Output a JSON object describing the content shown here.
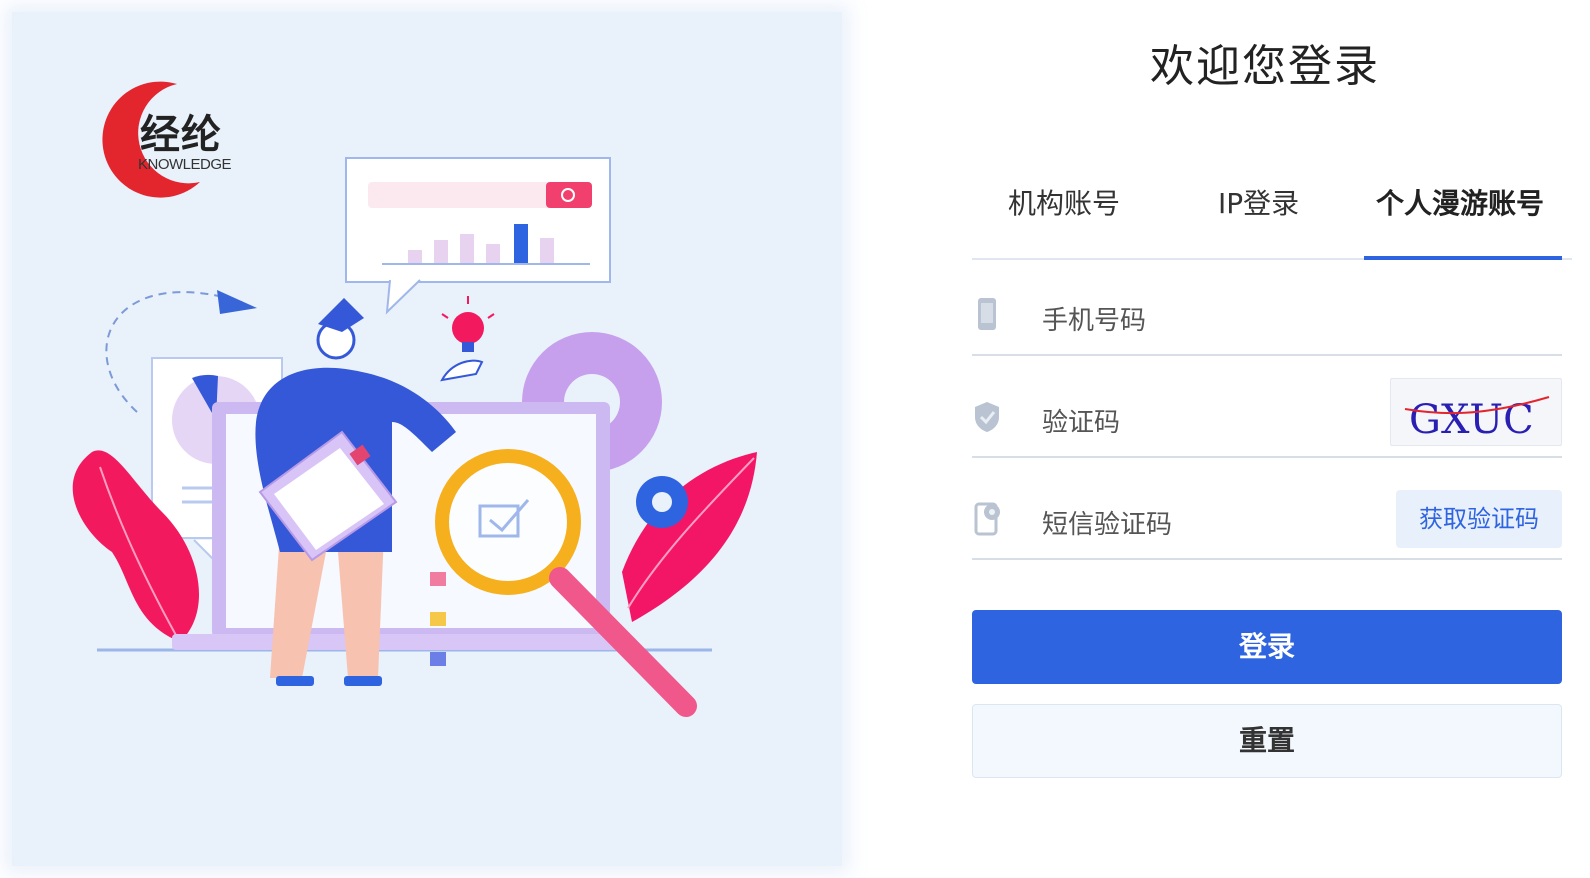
{
  "brand": {
    "logo_text_cn": "经纶",
    "logo_text_en": "KNOWLEDGE"
  },
  "login": {
    "title": "欢迎您登录",
    "tabs": [
      {
        "label": "机构账号",
        "active": false
      },
      {
        "label": "IP登录",
        "active": false
      },
      {
        "label": "个人漫游账号",
        "active": true
      }
    ],
    "fields": {
      "phone": {
        "placeholder": "手机号码",
        "icon": "phone-icon"
      },
      "captcha": {
        "placeholder": "验证码",
        "icon": "shield-check-icon",
        "captcha_text": "GXUC"
      },
      "sms": {
        "placeholder": "短信验证码",
        "icon": "sms-phone-icon",
        "button": "获取验证码"
      }
    },
    "buttons": {
      "login": "登录",
      "reset": "重置"
    }
  },
  "colors": {
    "accent": "#2f64e0",
    "panel_bg": "#e9f1fb",
    "logo_red": "#e3262e"
  }
}
